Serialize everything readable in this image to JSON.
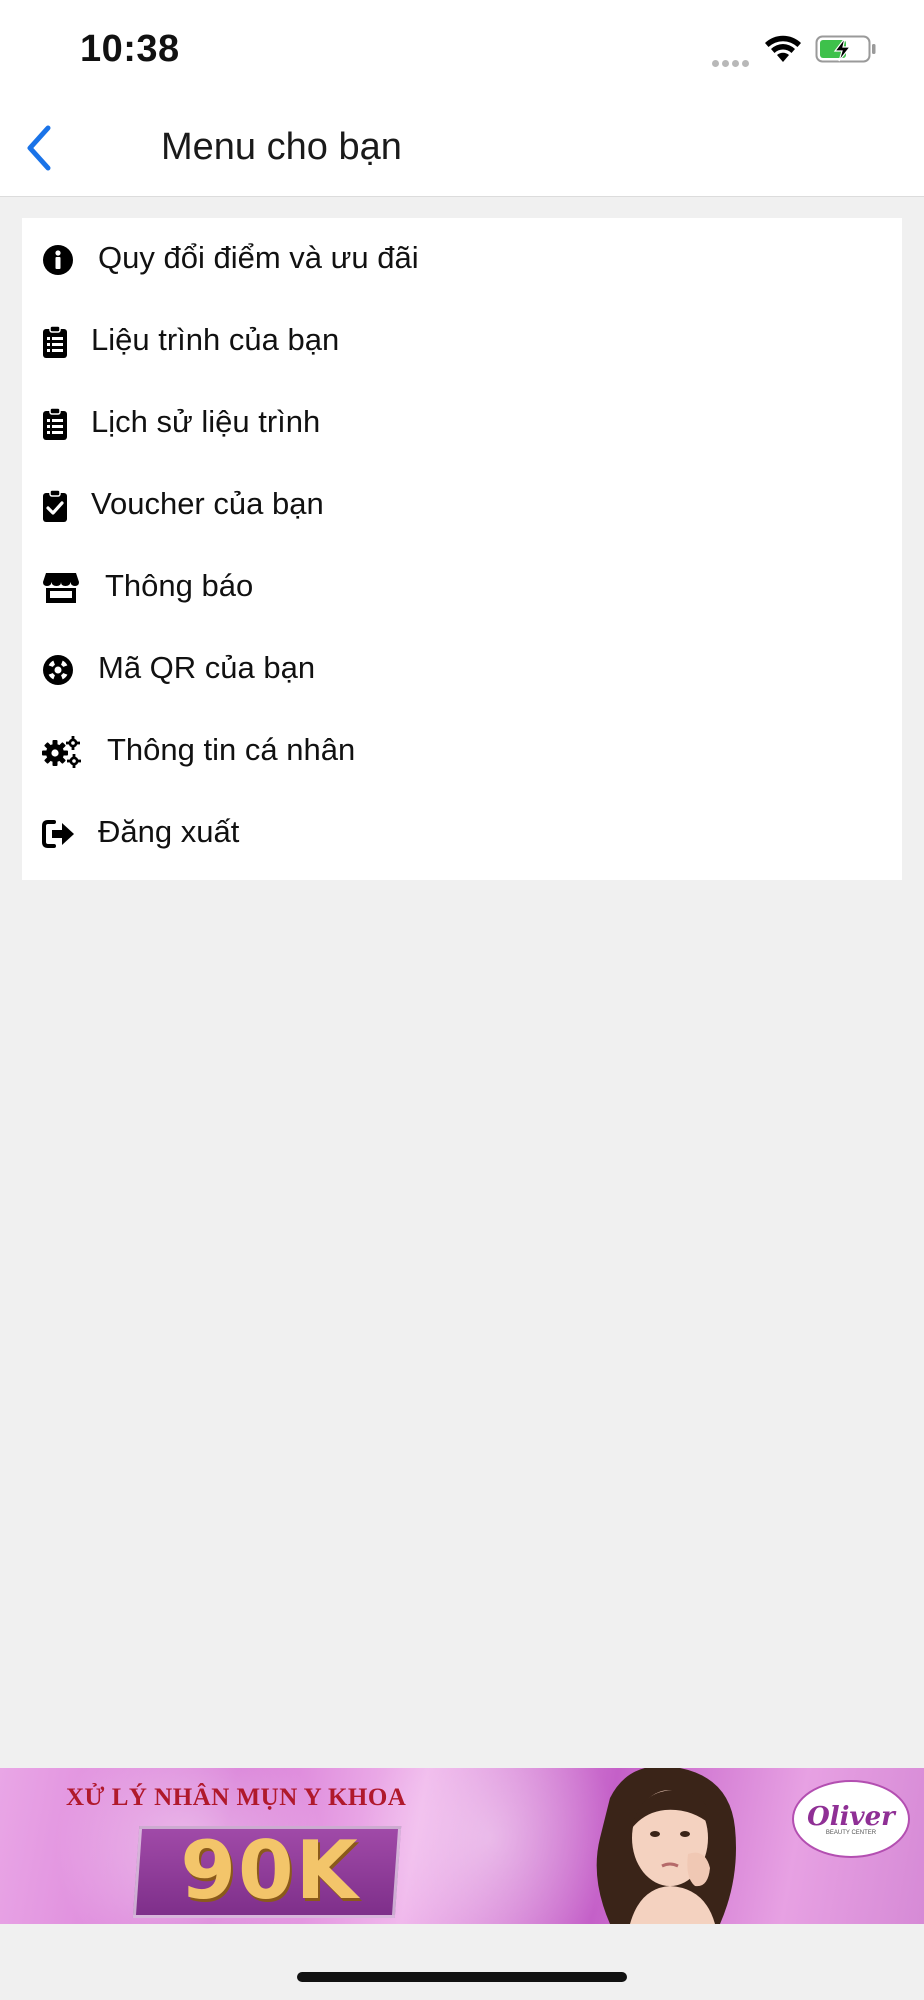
{
  "status_bar": {
    "time": "10:38"
  },
  "header": {
    "title": "Menu cho bạn"
  },
  "menu": {
    "items": [
      {
        "label": "Quy đổi điểm và ưu đãi",
        "icon": "info-circle-icon"
      },
      {
        "label": "Liệu trình của bạn",
        "icon": "clipboard-list-icon"
      },
      {
        "label": "Lịch sử liệu trình",
        "icon": "clipboard-list-icon"
      },
      {
        "label": "Voucher của bạn",
        "icon": "clipboard-check-icon"
      },
      {
        "label": "Thông báo",
        "icon": "store-icon"
      },
      {
        "label": "Mã QR của bạn",
        "icon": "life-ring-icon"
      },
      {
        "label": "Thông tin cá nhân",
        "icon": "cogs-icon"
      },
      {
        "label": "Đăng xuất",
        "icon": "sign-out-icon"
      }
    ]
  },
  "banner": {
    "headline": "XỬ LÝ NHÂN MỤN Y KHOA",
    "price": "90K",
    "logo_text": "Oliver",
    "logo_subtext": "BEAUTY CENTER"
  },
  "colors": {
    "accent": "#1a73e8",
    "background": "#f0f0f0",
    "card": "#ffffff"
  }
}
